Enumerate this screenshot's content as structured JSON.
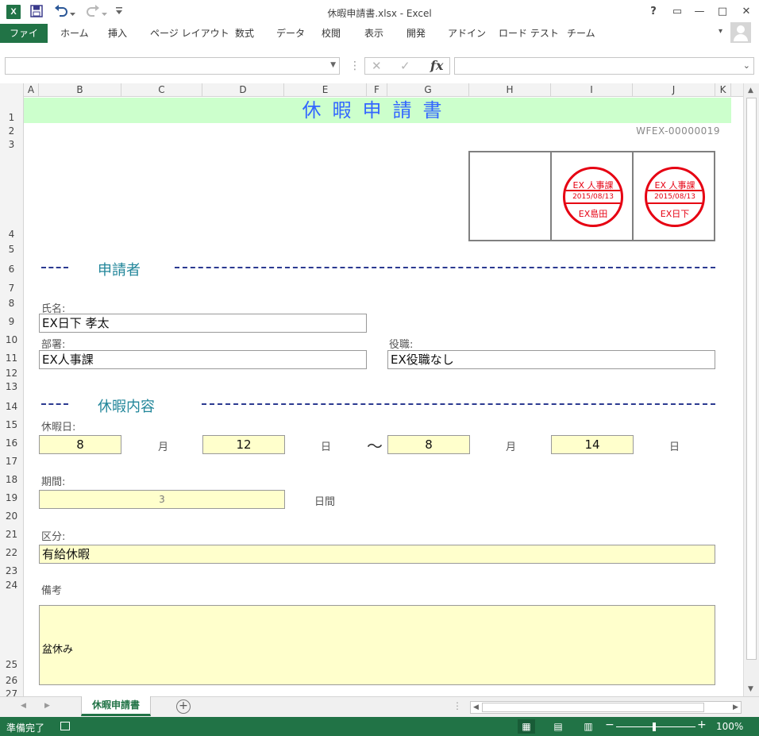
{
  "window": {
    "title": "休暇申請書.xlsx - Excel",
    "app_logo": "X",
    "help": "?",
    "minimize": "—",
    "maximize": "□",
    "close": "✕",
    "restore_ribbon": "▭"
  },
  "ribbon": {
    "tabs": [
      "ファイル",
      "ホーム",
      "挿入",
      "ページ レイアウト",
      "数式",
      "データ",
      "校閲",
      "表示",
      "開発",
      "アドイン",
      "ロード テスト",
      "チーム"
    ]
  },
  "formula_bar": {
    "name_box_value": "",
    "formula_value": "",
    "fx": "fx"
  },
  "columns": [
    "A",
    "B",
    "C",
    "D",
    "E",
    "F",
    "G",
    "H",
    "I",
    "J",
    "K"
  ],
  "rows": [
    "1",
    "2",
    "3",
    "4",
    "5",
    "6",
    "7",
    "8",
    "9",
    "10",
    "11",
    "12",
    "13",
    "14",
    "15",
    "16",
    "17",
    "18",
    "19",
    "20",
    "21",
    "22",
    "23",
    "24",
    "25",
    "26",
    "27"
  ],
  "form": {
    "title": "休暇申請書",
    "doc_number": "WFEX-00000019",
    "stamps": [
      {
        "dept": "EX 人事課",
        "date": "2015/08/13",
        "name": "EX島田"
      },
      {
        "dept": "EX 人事課",
        "date": "2015/08/13",
        "name": "EX日下"
      }
    ],
    "applicant_section": "申請者",
    "name_label": "氏名:",
    "name_value": "EX日下 孝太",
    "dept_label": "部署:",
    "dept_value": "EX人事課",
    "position_label": "役職:",
    "position_value": "EX役職なし",
    "leave_section": "休暇内容",
    "leave_date_label": "休暇日:",
    "start_month": "8",
    "month_unit": "月",
    "start_day": "12",
    "day_unit": "日",
    "range_sep": "～",
    "end_month": "8",
    "end_day": "14",
    "period_label": "期間:",
    "period_value": "3",
    "period_unit": "日間",
    "category_label": "区分:",
    "category_value": "有給休暇",
    "remarks_label": "備考",
    "remarks_value": "盆休み"
  },
  "sheet_tabs": {
    "active": "休暇申請書",
    "add": "+"
  },
  "status": {
    "text": "準備完了",
    "zoom": "100%",
    "zoom_out": "−",
    "zoom_in": "+"
  },
  "colors": {
    "excel_green": "#217346",
    "title_band": "#ccffcc",
    "title_text": "#3366ff",
    "section_text": "#22869a",
    "stamp_red": "#e60012",
    "input_yellow": "#ffffcc"
  }
}
